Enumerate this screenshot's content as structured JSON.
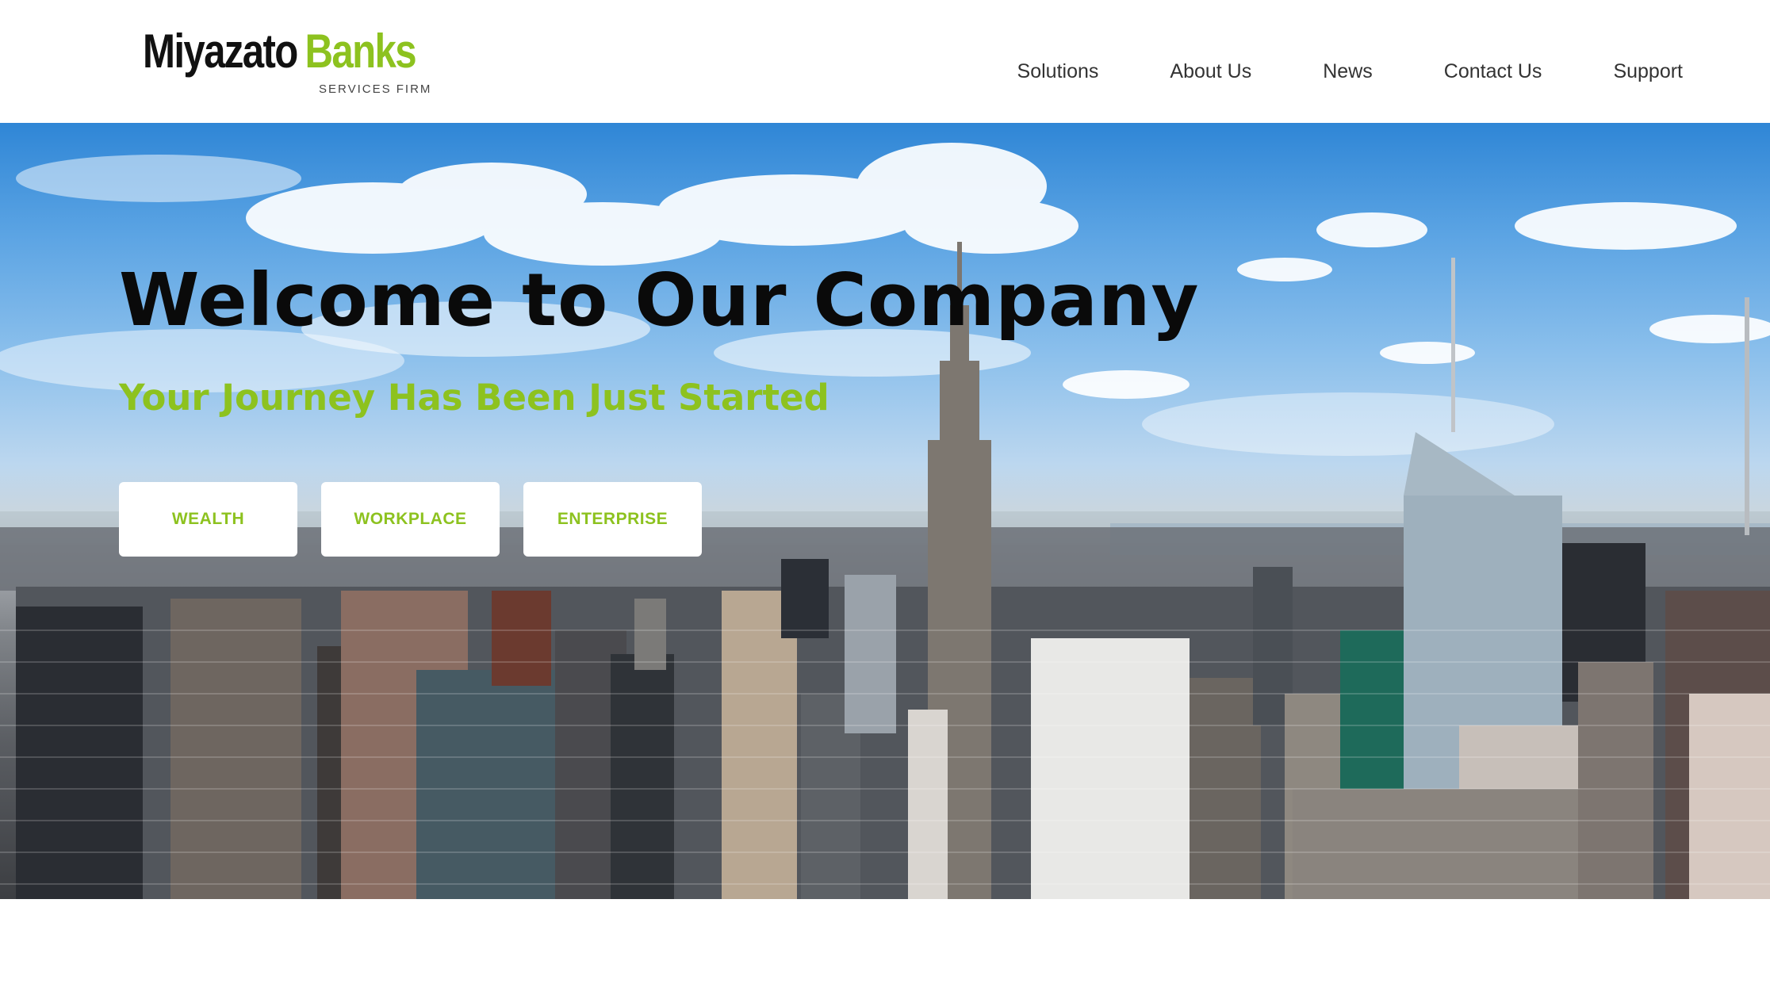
{
  "brand": {
    "name_part1": "Miyazato",
    "name_part2": "Banks",
    "tagline": "SERVICES FIRM"
  },
  "nav": {
    "items": [
      {
        "label": "Solutions"
      },
      {
        "label": "About Us"
      },
      {
        "label": "News"
      },
      {
        "label": "Contact Us"
      },
      {
        "label": "Support"
      }
    ]
  },
  "hero": {
    "title": "Welcome to Our Company",
    "subtitle": "Your Journey Has Been Just Started",
    "buttons": [
      {
        "label": "WEALTH"
      },
      {
        "label": "WORKPLACE"
      },
      {
        "label": "ENTERPRISE"
      }
    ],
    "background": "city-skyline-photo"
  },
  "colors": {
    "accent": "#8dc21f",
    "text_dark": "#0a0a0a",
    "nav_text": "#333333",
    "background": "#ffffff"
  }
}
